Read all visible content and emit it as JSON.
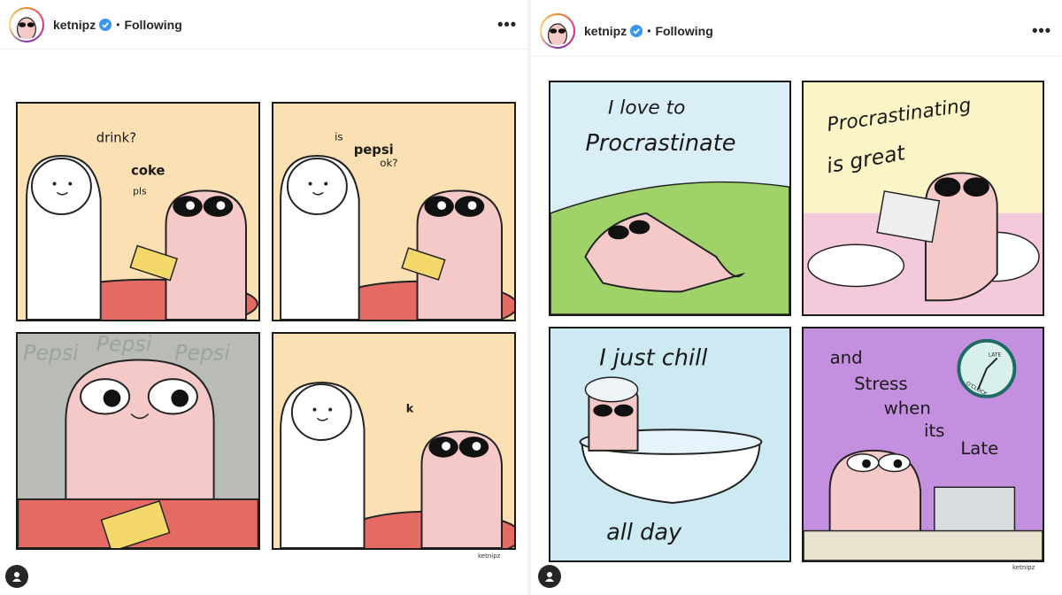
{
  "left_post": {
    "username": "ketnipz",
    "separator": "•",
    "follow_status": "Following",
    "more_label": "•••",
    "signature": "ketnipz",
    "panels": [
      {
        "texts": [
          "drink?",
          "coke",
          "pls"
        ]
      },
      {
        "texts": [
          "is",
          "pepsi",
          "ok?"
        ]
      },
      {
        "texts": [
          "Pepsi",
          "Pepsi",
          "Pepsi"
        ]
      },
      {
        "texts": [
          "k"
        ]
      }
    ]
  },
  "right_post": {
    "username": "ketnipz",
    "separator": "•",
    "follow_status": "Following",
    "more_label": "•••",
    "signature": "ketnipz",
    "panels": [
      {
        "texts": [
          "I love to",
          "Procrastinate"
        ]
      },
      {
        "texts": [
          "Procrastinating",
          "is great"
        ]
      },
      {
        "texts": [
          "I just chill",
          "all day"
        ]
      },
      {
        "texts": [
          "and",
          "Stress",
          "when",
          "its",
          "Late",
          "LATE",
          "O'CLOCK"
        ]
      }
    ]
  },
  "colors": {
    "verified_blue": "#3897f0",
    "panel_peach": "#fae0b2",
    "panel_gray": "#b9bcb6",
    "panel_sky": "#d9eef7",
    "panel_yellow": "#fbf4c6",
    "panel_lightblue": "#cde9f2",
    "panel_purple": "#c58fe0",
    "table_red": "#e46b63",
    "character_pink": "#f6c9c9"
  },
  "icons": {
    "more": "ellipsis-icon",
    "verified": "verified-badge-icon",
    "tag": "tagged-user-icon"
  }
}
